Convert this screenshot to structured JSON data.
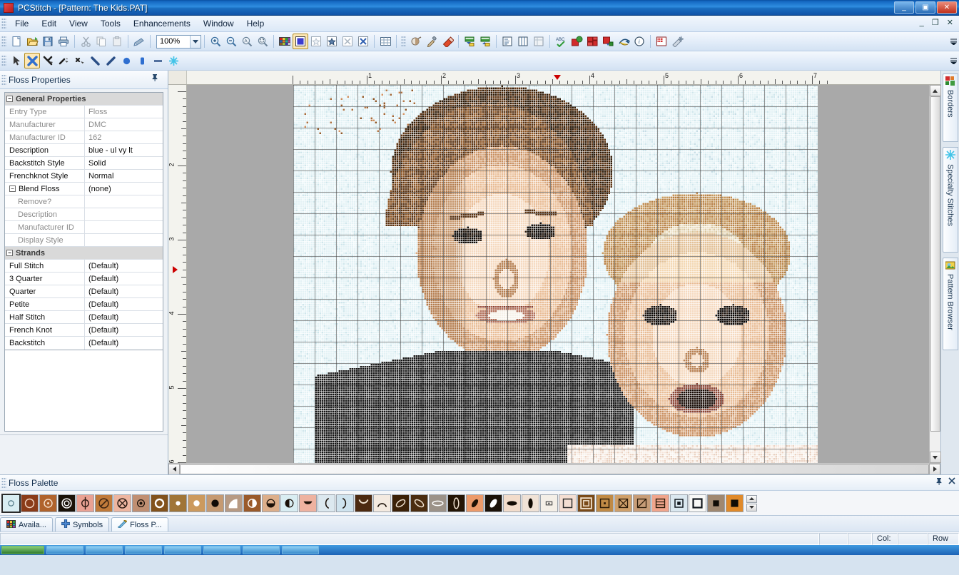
{
  "window": {
    "title": "PCStitch - [Pattern: The Kids.PAT]",
    "app_icon": "app-icon",
    "controls": {
      "minimize": "_",
      "restore": "▣",
      "close": "✕"
    },
    "mdi_controls": {
      "minimize": "_",
      "restore": "❐",
      "close": "✕"
    }
  },
  "menu": {
    "items": [
      "File",
      "Edit",
      "View",
      "Tools",
      "Enhancements",
      "Window",
      "Help"
    ]
  },
  "toolbar_standard": {
    "zoom_value": "100%",
    "buttons": [
      {
        "name": "new-document-button",
        "icon": "new-page-icon"
      },
      {
        "name": "open-file-button",
        "icon": "open-folder-icon"
      },
      {
        "name": "save-button",
        "icon": "floppy-disk-icon"
      },
      {
        "name": "print-button",
        "icon": "printer-icon"
      },
      {
        "name": "cut-button",
        "icon": "scissors-icon"
      },
      {
        "name": "copy-button",
        "icon": "copy-icon"
      },
      {
        "name": "paste-button",
        "icon": "clipboard-icon"
      },
      {
        "name": "format-painter-button",
        "icon": "paintbrush-icon"
      },
      {
        "name": "zoom-in-button",
        "icon": "magnifier-plus-icon"
      },
      {
        "name": "zoom-out-button",
        "icon": "magnifier-minus-icon"
      },
      {
        "name": "zoom-fit-button",
        "icon": "magnifier-page-icon"
      },
      {
        "name": "zoom-selection-button",
        "icon": "magnifier-region-icon"
      },
      {
        "name": "palette-button",
        "icon": "color-palette-icon"
      },
      {
        "name": "view-blocks-button",
        "icon": "solid-block-icon"
      },
      {
        "name": "view-symbols-light-button",
        "icon": "symbol-light-icon"
      },
      {
        "name": "view-symbols-button",
        "icon": "symbol-dark-icon"
      },
      {
        "name": "view-stitches-button",
        "icon": "x-stitch-icon"
      },
      {
        "name": "view-stitches-bold-button",
        "icon": "x-stitch-bold-icon"
      },
      {
        "name": "grid-toggle-button",
        "icon": "grid-icon"
      },
      {
        "name": "shade-button",
        "icon": "shade-icon"
      },
      {
        "name": "eyedropper-button",
        "icon": "eyedropper-icon"
      },
      {
        "name": "eraser-button",
        "icon": "eraser-icon"
      },
      {
        "name": "import-import-button",
        "icon": "import-arrow-icon"
      },
      {
        "name": "export-button",
        "icon": "export-arrow-icon"
      },
      {
        "name": "list-view-button",
        "icon": "list-icon"
      },
      {
        "name": "columns-view-button",
        "icon": "columns-icon"
      },
      {
        "name": "report-view-button",
        "icon": "report-icon"
      },
      {
        "name": "spell-check-button",
        "icon": "abc-check-icon"
      },
      {
        "name": "floss-usage-button",
        "icon": "floss-globe-icon"
      },
      {
        "name": "color-blocks-button",
        "icon": "color-blocks-icon"
      },
      {
        "name": "color-fill-button",
        "icon": "color-fill-icon"
      },
      {
        "name": "undo-history-button",
        "icon": "curved-arrow-icon"
      },
      {
        "name": "info-button",
        "icon": "info-icon"
      },
      {
        "name": "pattern-properties-button",
        "icon": "pattern-page-icon"
      },
      {
        "name": "design-wizard-button",
        "icon": "wizard-icon"
      }
    ]
  },
  "toolbar_tools": {
    "buttons": [
      {
        "name": "select-tool",
        "icon": "arrow-cursor-icon",
        "selected": false
      },
      {
        "name": "full-stitch-tool",
        "icon": "cross-stitch-icon",
        "selected": true
      },
      {
        "name": "three-quarter-stitch-tool",
        "icon": "three-quarter-stitch-icon",
        "selected": false
      },
      {
        "name": "quarter-stitch-tool",
        "icon": "quarter-stitch-icon",
        "selected": false
      },
      {
        "name": "petite-stitch-tool",
        "icon": "petite-stitch-icon",
        "selected": false
      },
      {
        "name": "backslash-half-stitch-tool",
        "icon": "backslash-stitch-icon",
        "selected": false
      },
      {
        "name": "slash-half-stitch-tool",
        "icon": "slash-stitch-icon",
        "selected": false
      },
      {
        "name": "french-knot-tool",
        "icon": "french-knot-icon",
        "selected": false
      },
      {
        "name": "bead-tool",
        "icon": "bead-icon",
        "selected": false
      },
      {
        "name": "backstitch-tool",
        "icon": "backstitch-line-icon",
        "selected": false
      },
      {
        "name": "specialty-stitch-tool",
        "icon": "starburst-icon",
        "selected": false
      }
    ]
  },
  "floss_properties": {
    "panel_title": "Floss Properties",
    "pin_icon": "pin-icon",
    "close_icon": "close-icon",
    "groups": [
      {
        "name": "General Properties",
        "rows": [
          {
            "label": "Entry Type",
            "value": "Floss",
            "dim": true,
            "indent": false
          },
          {
            "label": "Manufacturer",
            "value": "DMC",
            "dim": true,
            "indent": false
          },
          {
            "label": "Manufacturer ID",
            "value": "162",
            "dim": true,
            "indent": false
          },
          {
            "label": "Description",
            "value": "blue - ul vy lt",
            "dim": false,
            "indent": false
          },
          {
            "label": "Backstitch Style",
            "value": "Solid",
            "dim": false,
            "indent": false
          },
          {
            "label": "Frenchknot Style",
            "value": "Normal",
            "dim": false,
            "indent": false
          }
        ]
      },
      {
        "name": "Blend Floss",
        "group_value": "(none)",
        "rows": [
          {
            "label": "Remove?",
            "value": "",
            "dim": true,
            "indent": true
          },
          {
            "label": "Description",
            "value": "",
            "dim": true,
            "indent": true
          },
          {
            "label": "Manufacturer ID",
            "value": "",
            "dim": true,
            "indent": true
          },
          {
            "label": "Display Style",
            "value": "",
            "dim": true,
            "indent": true
          }
        ]
      },
      {
        "name": "Strands",
        "rows": [
          {
            "label": "Full Stitch",
            "value": "(Default)",
            "dim": false,
            "indent": false
          },
          {
            "label": "3 Quarter",
            "value": "(Default)",
            "dim": false,
            "indent": false
          },
          {
            "label": "Quarter",
            "value": "(Default)",
            "dim": false,
            "indent": false
          },
          {
            "label": "Petite",
            "value": "(Default)",
            "dim": false,
            "indent": false
          },
          {
            "label": "Half Stitch",
            "value": "(Default)",
            "dim": false,
            "indent": false
          },
          {
            "label": "French Knot",
            "value": "(Default)",
            "dim": false,
            "indent": false
          },
          {
            "label": "Backstitch",
            "value": "(Default)",
            "dim": false,
            "indent": false
          }
        ]
      }
    ]
  },
  "rulers": {
    "horizontal_labels": [
      "1",
      "2",
      "3",
      "4",
      "5",
      "6",
      "7"
    ],
    "vertical_labels": [
      "2",
      "3",
      "4",
      "5",
      "6"
    ],
    "h_marker_position_label": "3.5",
    "v_marker_position_label": "3.4"
  },
  "right_tabs": [
    {
      "label": "Borders",
      "icon": "borders-icon"
    },
    {
      "label": "Specialty Stitches",
      "icon": "starburst-icon"
    },
    {
      "label": "Pattern Browser",
      "icon": "pattern-browser-icon"
    }
  ],
  "floss_palette": {
    "panel_title": "Floss Palette",
    "pin_icon": "pin-icon",
    "close_icon": "close-icon",
    "scroll_up_icon": "spin-up-icon",
    "scroll_down_icon": "spin-down-icon",
    "swatches": [
      {
        "bg": "#d9edf2",
        "fg": "#5a7f8c",
        "symbol": "circle-small-open",
        "selected": true
      },
      {
        "bg": "#8a3b18",
        "fg": "#f2d4c2",
        "symbol": "circle-open"
      },
      {
        "bg": "#b0632c",
        "fg": "#f6e0cd",
        "symbol": "circle-dot"
      },
      {
        "bg": "#1a1208",
        "fg": "#ffffff",
        "symbol": "double-circle"
      },
      {
        "bg": "#e9a193",
        "fg": "#2b1a12",
        "symbol": "circle-vertical-bar"
      },
      {
        "bg": "#c07a3a",
        "fg": "#3a2210",
        "symbol": "circle-slash"
      },
      {
        "bg": "#edb59f",
        "fg": "#2b1a12",
        "symbol": "circle-x"
      },
      {
        "bg": "#c08f72",
        "fg": "#1a1008",
        "symbol": "circle-filled-small"
      },
      {
        "bg": "#82521c",
        "fg": "#ffffff",
        "symbol": "circle-open-thick"
      },
      {
        "bg": "#a07537",
        "fg": "#ffffff",
        "symbol": "dot-filled"
      },
      {
        "bg": "#cc9a5e",
        "fg": "#ffffff",
        "symbol": "dot-filled-lg"
      },
      {
        "bg": "#c59a72",
        "fg": "#100a05",
        "symbol": "disc-black"
      },
      {
        "bg": "#b79a83",
        "fg": "#ffffff",
        "symbol": "quarter-arc"
      },
      {
        "bg": "#9a5a2a",
        "fg": "#ffffff",
        "symbol": "half-circle-vert"
      },
      {
        "bg": "#dcae8a",
        "fg": "#1a1008",
        "symbol": "half-disc-bottom"
      },
      {
        "bg": "#d9edf2",
        "fg": "#1a1008",
        "symbol": "half-disc-left"
      },
      {
        "bg": "#eeb2a0",
        "fg": "#1a1008",
        "symbol": "triangle-down-filled"
      },
      {
        "bg": "#dce8ef",
        "fg": "#1a1008",
        "symbol": "arc-left"
      },
      {
        "bg": "#cfe3ee",
        "fg": "#1a1008",
        "symbol": "arc-right"
      },
      {
        "bg": "#4d2a10",
        "fg": "#f0e2d0",
        "symbol": "cup-curve"
      },
      {
        "bg": "#f4eae0",
        "fg": "#1a1008",
        "symbol": "arch-curve"
      },
      {
        "bg": "#3b2108",
        "fg": "#f0e2d0",
        "symbol": "ellipse-diag-open"
      },
      {
        "bg": "#4a2c10",
        "fg": "#f0e2d0",
        "symbol": "ellipse-diag2-open"
      },
      {
        "bg": "#9c9288",
        "fg": "#ffffff",
        "symbol": "ellipse-horizontal-open"
      },
      {
        "bg": "#241505",
        "fg": "#f0e2d0",
        "symbol": "ellipse-vertical-open"
      },
      {
        "bg": "#ec9a6a",
        "fg": "#201206",
        "symbol": "ellipse-diag-filled"
      },
      {
        "bg": "#1c1208",
        "fg": "#ffffff",
        "symbol": "ellipse-diag-white"
      },
      {
        "bg": "#f2dccb",
        "fg": "#120b04",
        "symbol": "ellipse-horizontal-filled"
      },
      {
        "bg": "#f0e2d6",
        "fg": "#120b04",
        "symbol": "ellipse-vertical-filled"
      },
      {
        "bg": "#f4efe7",
        "fg": "#4a4a4a",
        "symbol": "rect-small-open"
      },
      {
        "bg": "#f4ded2",
        "fg": "#2a2a2a",
        "symbol": "square-open"
      },
      {
        "bg": "#7a4a18",
        "fg": "#f0e0cc",
        "symbol": "square-nested"
      },
      {
        "bg": "#c08a45",
        "fg": "#2a1a08",
        "symbol": "square-dot"
      },
      {
        "bg": "#cfa06a",
        "fg": "#2a1a08",
        "symbol": "square-x"
      },
      {
        "bg": "#c79d78",
        "fg": "#2a1a08",
        "symbol": "square-slash"
      },
      {
        "bg": "#f0a58c",
        "fg": "#2a1a08",
        "symbol": "square-bars"
      },
      {
        "bg": "#dbe8f0",
        "fg": "#10161c",
        "symbol": "square-filled-small"
      },
      {
        "bg": "#f8f8f6",
        "fg": "#10161c",
        "symbol": "square-outline-thick"
      },
      {
        "bg": "#a08870",
        "fg": "#100c06",
        "symbol": "square-filled"
      },
      {
        "bg": "#e08a2a",
        "fg": "#100c06",
        "symbol": "square-filled-lg"
      }
    ]
  },
  "bottom_tabs": [
    {
      "label": "Availa...",
      "icon": "palette-grid-icon"
    },
    {
      "label": "Symbols",
      "icon": "plus-badge-icon"
    },
    {
      "label": "Floss P...",
      "icon": "pencil-icon"
    }
  ],
  "status_bar": {
    "column_label": "Col:",
    "column_value": "",
    "row_label": "Row",
    "row_value": ""
  },
  "canvas": {
    "background_color": "#a9a9a9",
    "fabric_color": "#e3f2f5",
    "description": "cross-stitch pattern of two children photographed converted to stitches"
  }
}
